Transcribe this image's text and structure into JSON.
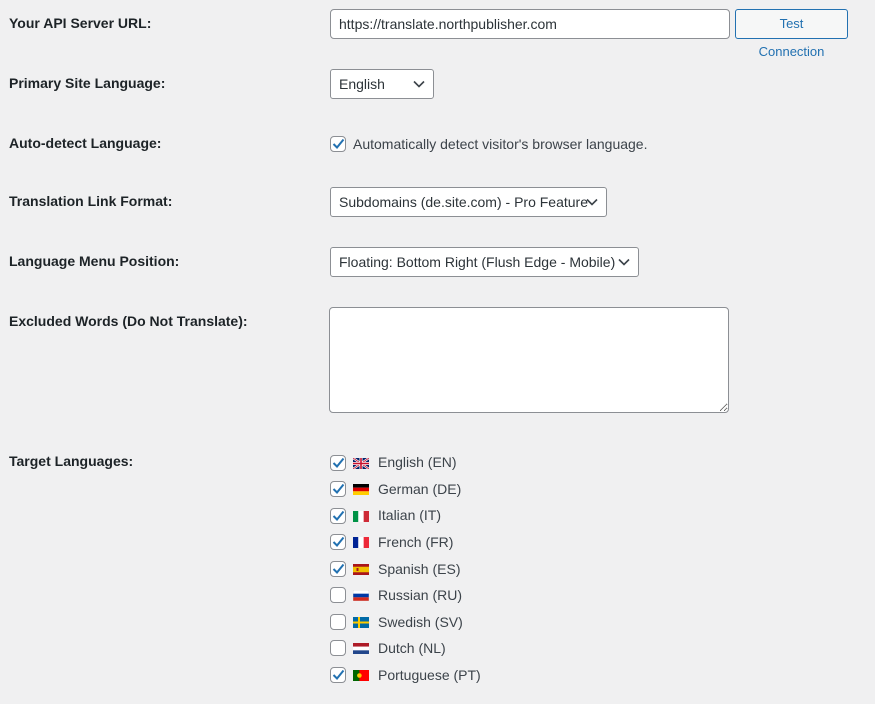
{
  "api_url": {
    "label": "Your API Server URL:",
    "value": "https://translate.northpublisher.com",
    "test_button": "Test Connection"
  },
  "primary_language": {
    "label": "Primary Site Language:",
    "selected": "English"
  },
  "auto_detect": {
    "label": "Auto-detect Language:",
    "checked": true,
    "text": "Automatically detect visitor's browser language."
  },
  "link_format": {
    "label": "Translation Link Format:",
    "selected": "Subdomains (de.site.com) - Pro Feature"
  },
  "menu_position": {
    "label": "Language Menu Position:",
    "selected": "Floating: Bottom Right (Flush Edge - Mobile)"
  },
  "excluded_words": {
    "label": "Excluded Words (Do Not Translate):",
    "value": ""
  },
  "target_languages": {
    "label": "Target Languages:",
    "items": [
      {
        "label": "English (EN)",
        "checked": true,
        "flag": "gb-flag-icon"
      },
      {
        "label": "German (DE)",
        "checked": true,
        "flag": "de-flag-icon"
      },
      {
        "label": "Italian (IT)",
        "checked": true,
        "flag": "it-flag-icon"
      },
      {
        "label": "French (FR)",
        "checked": true,
        "flag": "fr-flag-icon"
      },
      {
        "label": "Spanish (ES)",
        "checked": true,
        "flag": "es-flag-icon"
      },
      {
        "label": "Russian (RU)",
        "checked": false,
        "flag": "ru-flag-icon"
      },
      {
        "label": "Swedish (SV)",
        "checked": false,
        "flag": "se-flag-icon"
      },
      {
        "label": "Dutch (NL)",
        "checked": false,
        "flag": "nl-flag-icon"
      },
      {
        "label": "Portuguese (PT)",
        "checked": true,
        "flag": "pt-flag-icon"
      }
    ]
  },
  "colors": {
    "background": "#f0f0f1",
    "accent": "#2271b1",
    "border": "#8c8f94",
    "text": "#1d2327"
  }
}
